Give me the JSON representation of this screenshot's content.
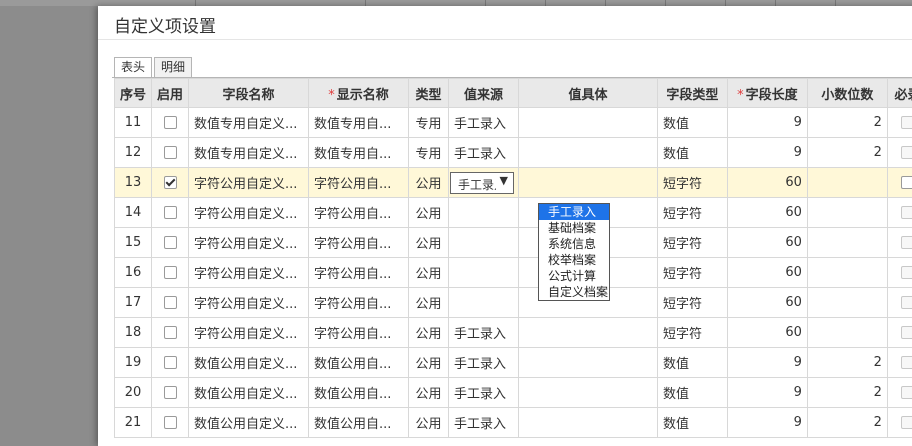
{
  "dialog": {
    "title": "自定义项设置"
  },
  "tabs": [
    {
      "label": "表头",
      "active": true
    },
    {
      "label": "明细",
      "active": false
    }
  ],
  "columns": [
    {
      "label": "序号",
      "required": false
    },
    {
      "label": "启用",
      "required": false
    },
    {
      "label": "字段名称",
      "required": false
    },
    {
      "label": "显示名称",
      "required": true
    },
    {
      "label": "类型",
      "required": false
    },
    {
      "label": "值来源",
      "required": false
    },
    {
      "label": "值具体",
      "required": false
    },
    {
      "label": "字段类型",
      "required": false
    },
    {
      "label": "字段长度",
      "required": true
    },
    {
      "label": "小数位数",
      "required": false
    },
    {
      "label": "必录",
      "required": false
    }
  ],
  "rows": [
    {
      "no": "11",
      "enabled": false,
      "field_name": "数值专用自定义...",
      "display_name": "数值专用自...",
      "type": "专用",
      "source": "手工录入",
      "detail": "",
      "field_type": "数值",
      "length": "9",
      "decimals": "2"
    },
    {
      "no": "12",
      "enabled": false,
      "field_name": "数值专用自定义...",
      "display_name": "数值专用自...",
      "type": "专用",
      "source": "手工录入",
      "detail": "",
      "field_type": "数值",
      "length": "9",
      "decimals": "2"
    },
    {
      "no": "13",
      "enabled": true,
      "field_name": "字符公用自定义...",
      "display_name": "字符公用自...",
      "type": "公用",
      "source": "手工录入",
      "detail": "",
      "field_type": "短字符",
      "length": "60",
      "decimals": "",
      "selected": true
    },
    {
      "no": "14",
      "enabled": false,
      "field_name": "字符公用自定义...",
      "display_name": "字符公用自...",
      "type": "公用",
      "source": "",
      "detail": "",
      "field_type": "短字符",
      "length": "60",
      "decimals": ""
    },
    {
      "no": "15",
      "enabled": false,
      "field_name": "字符公用自定义...",
      "display_name": "字符公用自...",
      "type": "公用",
      "source": "",
      "detail": "",
      "field_type": "短字符",
      "length": "60",
      "decimals": ""
    },
    {
      "no": "16",
      "enabled": false,
      "field_name": "字符公用自定义...",
      "display_name": "字符公用自...",
      "type": "公用",
      "source": "",
      "detail": "",
      "field_type": "短字符",
      "length": "60",
      "decimals": ""
    },
    {
      "no": "17",
      "enabled": false,
      "field_name": "字符公用自定义...",
      "display_name": "字符公用自...",
      "type": "公用",
      "source": "",
      "detail": "",
      "field_type": "短字符",
      "length": "60",
      "decimals": ""
    },
    {
      "no": "18",
      "enabled": false,
      "field_name": "字符公用自定义...",
      "display_name": "字符公用自...",
      "type": "公用",
      "source": "手工录入",
      "detail": "",
      "field_type": "短字符",
      "length": "60",
      "decimals": ""
    },
    {
      "no": "19",
      "enabled": false,
      "field_name": "数值公用自定义...",
      "display_name": "数值公用自...",
      "type": "公用",
      "source": "手工录入",
      "detail": "",
      "field_type": "数值",
      "length": "9",
      "decimals": "2"
    },
    {
      "no": "20",
      "enabled": false,
      "field_name": "数值公用自定义...",
      "display_name": "数值公用自...",
      "type": "公用",
      "source": "手工录入",
      "detail": "",
      "field_type": "数值",
      "length": "9",
      "decimals": "2"
    },
    {
      "no": "21",
      "enabled": false,
      "field_name": "数值公用自定义...",
      "display_name": "数值公用自...",
      "type": "公用",
      "source": "手工录入",
      "detail": "",
      "field_type": "数值",
      "length": "9",
      "decimals": "2"
    }
  ],
  "select": {
    "value": "手工录入"
  },
  "dropdown": {
    "options": [
      "手工录入",
      "基础档案",
      "系统信息",
      "校举档案",
      "公式计算",
      "自定义档案"
    ],
    "highlighted": 0
  },
  "colors": {
    "selected_row": "#fff8d8",
    "highlight": "#1e73e8",
    "required_mark": "#e03b3b"
  }
}
